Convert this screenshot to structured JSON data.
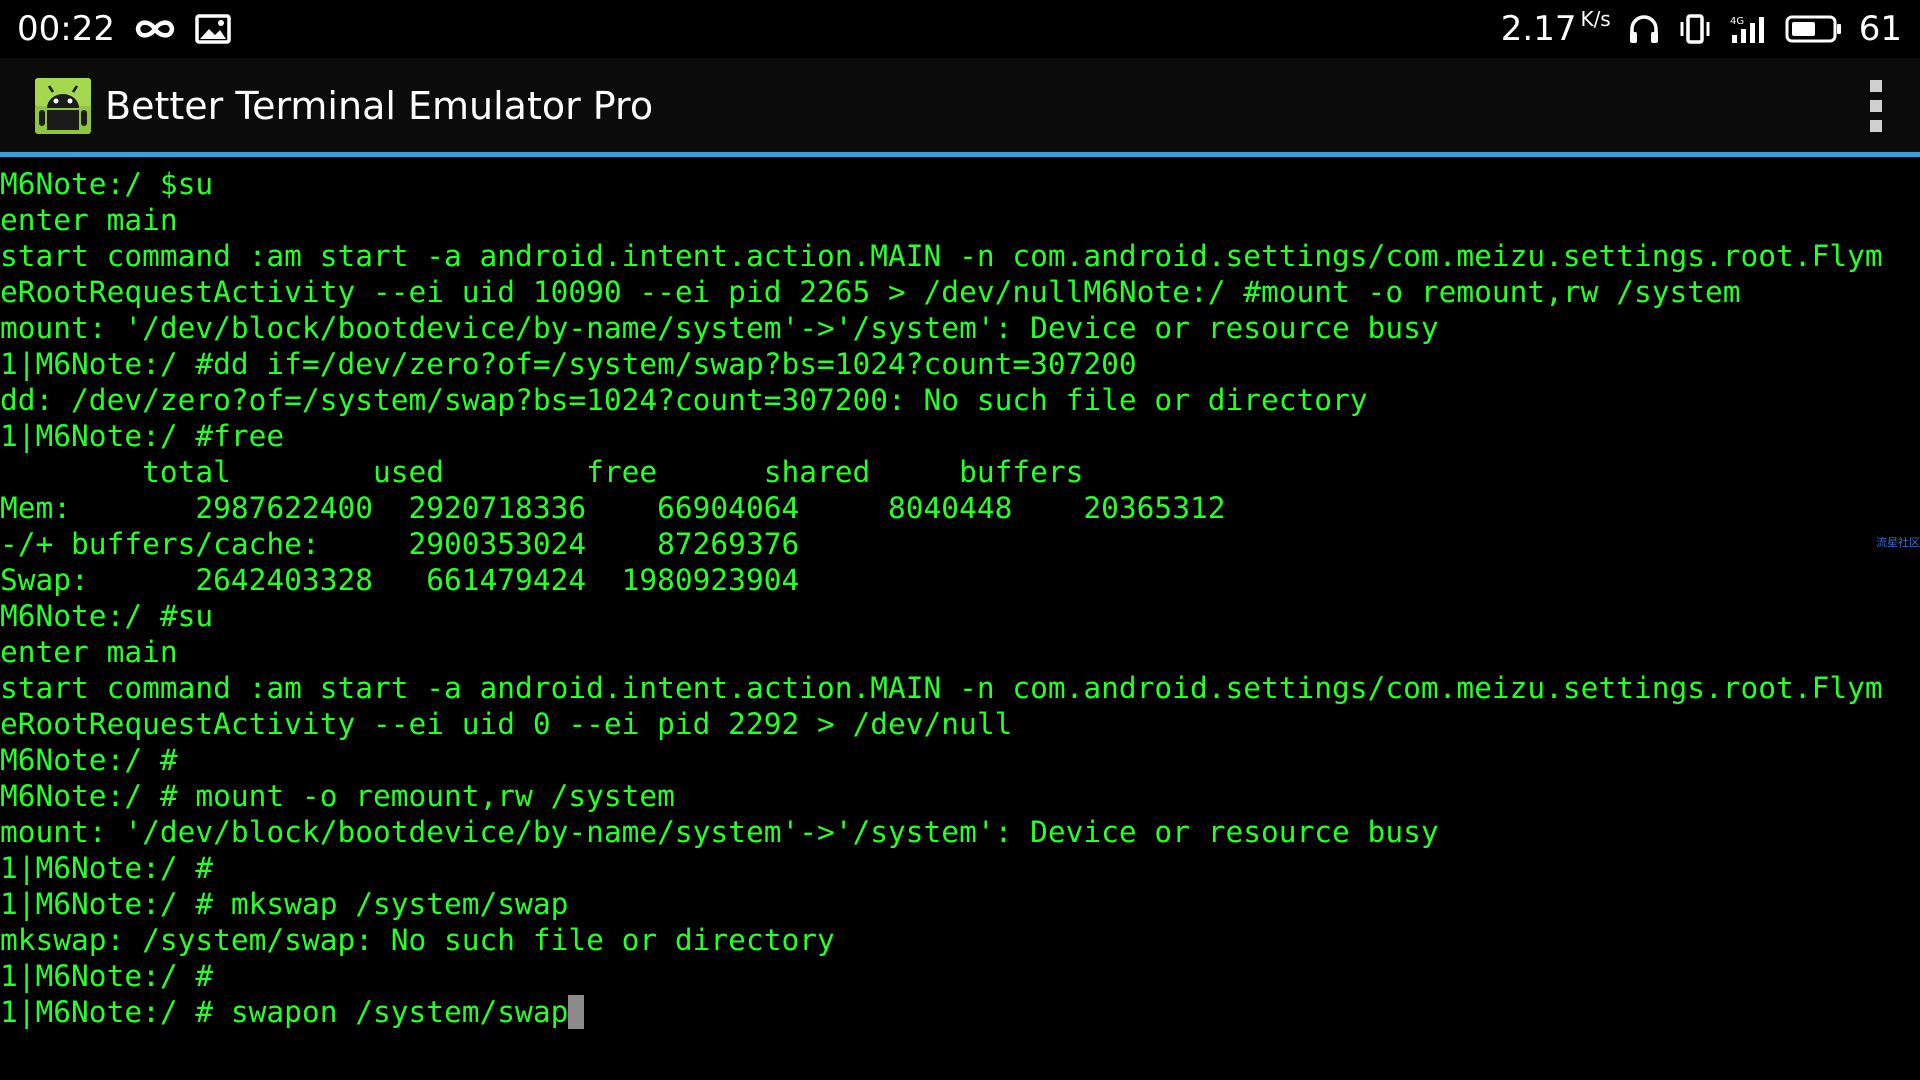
{
  "status_bar": {
    "time": "00:22",
    "left_icons": [
      "infinity-icon",
      "image-notification-icon"
    ],
    "net_speed_value": "2.17",
    "net_speed_unit": "K/s",
    "right_icons": [
      "headphones-icon",
      "vibrate-icon",
      "signal-4g-icon",
      "battery-icon"
    ],
    "network_type": "4G",
    "battery_level": "61"
  },
  "app_bar": {
    "title": "Better Terminal Emulator Pro",
    "icon": "android-app-icon",
    "menu_icon": "overflow-menu-icon"
  },
  "colors": {
    "terminal_text": "#27ff2b",
    "accent": "#3aa0d8",
    "cursor": "#8c8c8c",
    "background": "#000000"
  },
  "terminal": {
    "lines": [
      "M6Note:/ $su",
      "enter main",
      "start command :am start -a android.intent.action.MAIN -n com.android.settings/com.meizu.settings.root.Flym",
      "eRootRequestActivity --ei uid 10090 --ei pid 2265 > /dev/nullM6Note:/ #mount -o remount,rw /system",
      "mount: '/dev/block/bootdevice/by-name/system'->'/system': Device or resource busy",
      "1|M6Note:/ #dd if=/dev/zero?of=/system/swap?bs=1024?count=307200",
      "dd: /dev/zero?of=/system/swap?bs=1024?count=307200: No such file or directory",
      "1|M6Note:/ #free",
      "        total        used        free      shared     buffers",
      "Mem:       2987622400  2920718336    66904064     8040448    20365312",
      "-/+ buffers/cache:     2900353024    87269376",
      "Swap:      2642403328   661479424  1980923904",
      "M6Note:/ #su",
      "enter main",
      "start command :am start -a android.intent.action.MAIN -n com.android.settings/com.meizu.settings.root.Flym",
      "eRootRequestActivity --ei uid 0 --ei pid 2292 > /dev/null",
      "M6Note:/ #",
      "M6Note:/ # mount -o remount,rw /system",
      "mount: '/dev/block/bootdevice/by-name/system'->'/system': Device or resource busy",
      "1|M6Note:/ #",
      "1|M6Note:/ # mkswap /system/swap",
      "mkswap: /system/swap: No such file or directory",
      "1|M6Note:/ #"
    ],
    "input_line": "1|M6Note:/ # swapon /system/swap"
  },
  "watermark": "流星社区"
}
